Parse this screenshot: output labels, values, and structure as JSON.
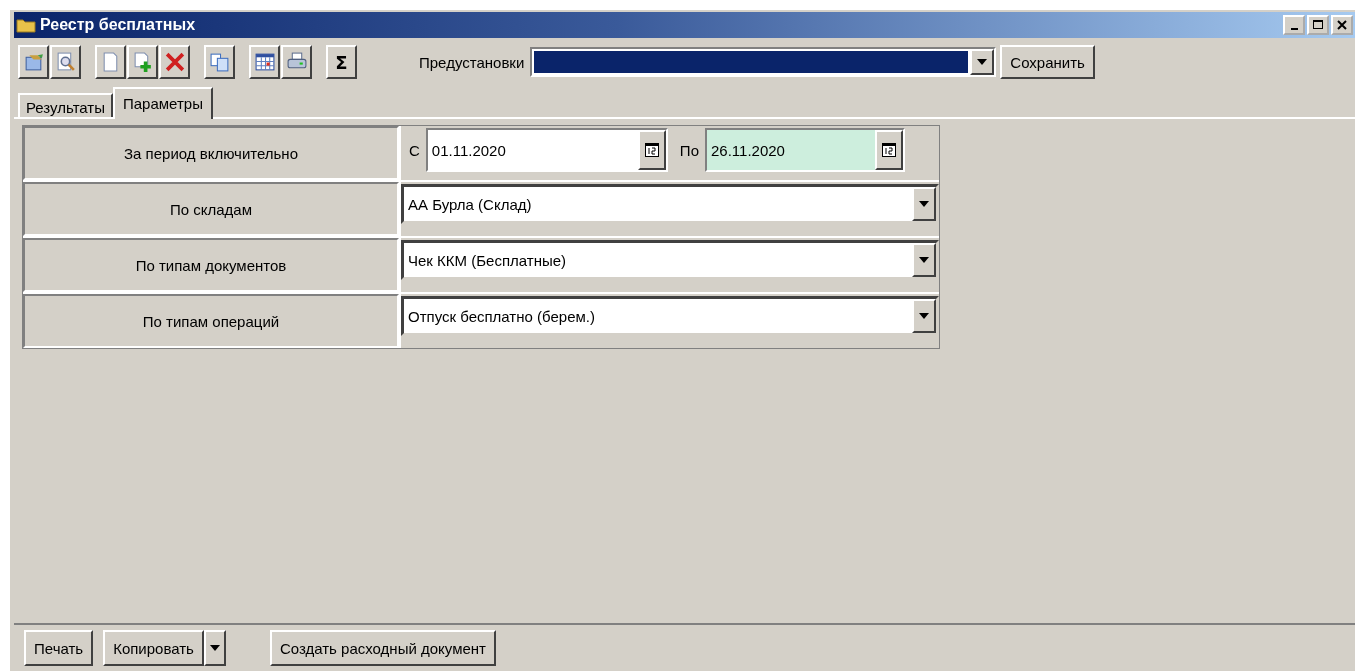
{
  "window": {
    "title": "Реестр бесплатных"
  },
  "toolbar": {
    "groups": [
      [
        {
          "kind": "properties"
        },
        {
          "kind": "preview"
        }
      ],
      [
        {
          "kind": "new"
        },
        {
          "kind": "add"
        },
        {
          "kind": "delete"
        }
      ],
      [
        {
          "kind": "copy"
        }
      ],
      [
        {
          "kind": "calendar"
        },
        {
          "kind": "print"
        }
      ],
      [
        {
          "kind": "sum",
          "label": "Σ"
        }
      ]
    ],
    "presets_label": "Предустановки",
    "presets_field": {
      "focused": true
    },
    "save_button": "Сохранить"
  },
  "tabs": [
    {
      "label": "Результаты",
      "selected": false
    },
    {
      "label": "Параметры",
      "selected": true
    }
  ],
  "parameters": [
    {
      "label": "За период включительно",
      "kind": "date_range",
      "from_label": "С",
      "from": {
        "value": "01.11.2020",
        "highlighted": false
      },
      "to_label": "По",
      "to": {
        "value": "26.11.2020",
        "highlighted": true
      }
    },
    {
      "label": "По складам",
      "kind": "dropdown",
      "value": "АА Бурла (Склад)"
    },
    {
      "label": "По типам документов",
      "kind": "dropdown",
      "value": "Чек ККМ (Бесплатные)"
    },
    {
      "label": "По типам операций",
      "kind": "dropdown",
      "value": "Отпуск бесплатно (берем.)"
    }
  ],
  "buttons": [
    {
      "label": "Печать",
      "kind": "plain"
    },
    {
      "label": "Копировать",
      "kind": "split"
    },
    {
      "label": "Создать расходный документ",
      "kind": "plain"
    }
  ]
}
